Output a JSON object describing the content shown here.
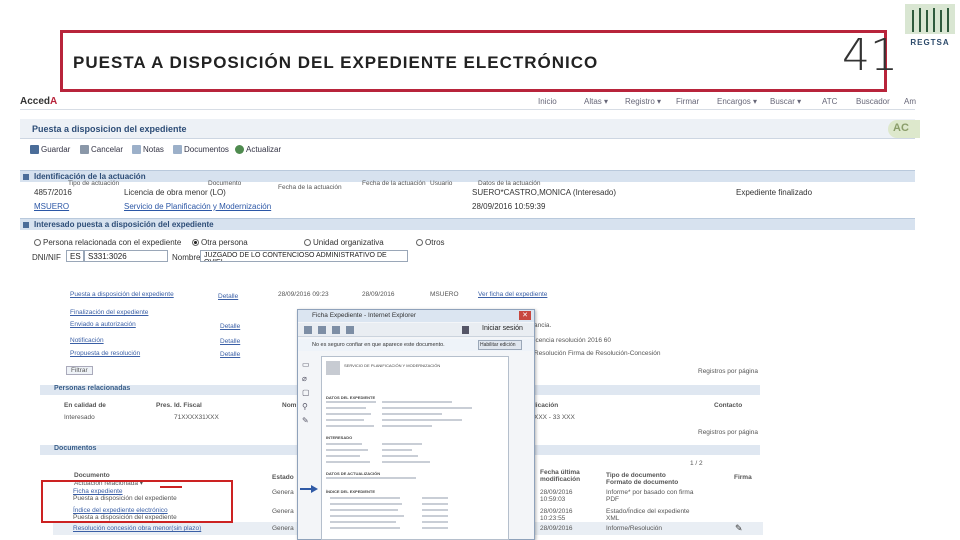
{
  "slide": {
    "title": "PUESTA A DISPOSICIÓN DEL EXPEDIENTE ELECTRÓNICO",
    "number": "41",
    "logo_text": "REGTSA"
  },
  "app": {
    "brand_prefix": "Acced",
    "brand_suffix": "A",
    "nav": [
      "Inicio",
      "Altas ▾",
      "Registro ▾",
      "Firmar",
      "Encargos ▾",
      "Buscar ▾",
      "ATC",
      "Buscador",
      "Am"
    ],
    "page_title": "Puesta a disposicion del expediente",
    "badge": "AC",
    "toolbar": [
      "Guardar",
      "Cancelar",
      "Notas",
      "Documentos",
      "Actualizar"
    ],
    "section_id": "Identificación de la actuación",
    "act": {
      "number": "4857/2016",
      "type": "Licencia de obra menor (LO)",
      "person": "SUERO*CASTRO,MONICA (Interesado)",
      "status": "Expediente finalizado",
      "user": "MSUERO",
      "service": "Servicio de Planificación y Modernización",
      "datetime": "28/09/2016 10:59:39"
    },
    "section_int": "Interesado puesta a disposición del expediente",
    "options": [
      "Persona relacionada con el expediente",
      "Otra persona",
      "Unidad organizativa",
      "Otros"
    ],
    "dni_label": "DNI/NIF",
    "dni_type": "ES",
    "dni_value": "S331:3026",
    "name_label": "Nombre",
    "name_value": "JUZGADO DE LO CONTENCIOSO ADMINISTRATIVO DE OVIEI"
  },
  "lower": {
    "header": [
      "Tipo de actuación",
      "Documento",
      "Fecha de la actuación",
      "Fecha de la actuación",
      "Usuario",
      "Datos de la actuación"
    ],
    "row1": {
      "type": "Puesta a disposición del expediente",
      "doc": "Detalle",
      "date1": "28/09/2016 09:23",
      "date2": "28/09/2016",
      "user": "MSUERO",
      "data": "Ver ficha del expediente"
    },
    "rows": [
      "Finalización del expediente",
      "Enviado a autorización",
      "Notificación",
      "Propuesta de resolución"
    ],
    "detail": "Detalle",
    "right_notes": [
      "ancia.",
      "icencia resolución 2016 60",
      "Resolución Firma de Resolución-Concesión"
    ],
    "filter": "Filtrar",
    "per_page": "Registros por página",
    "persons_title": "Personas relacionadas",
    "persons_cols": [
      "En calidad de",
      "Pres.",
      "Id. Fiscal",
      "Nom",
      "licación",
      "Contacto"
    ],
    "person": {
      "role": "Interesado",
      "id": "71XXXX31XXX",
      "loc": "XXX - 33 XXX"
    },
    "docs_title": "Documentos",
    "docs_cols": [
      "Documento",
      "Estado",
      "Fecha última modificación",
      "Tipo de documento",
      "Firma"
    ],
    "docs_sub": [
      "Actuación relacionada ▾",
      "Formato de documento"
    ],
    "pager": "1 / 2",
    "docs": [
      {
        "name": "Ficha expediente",
        "sub": "Puesta a disposición del expediente",
        "state": "Genera",
        "date": "28/09/2016",
        "time": "10:59:03",
        "type": "Informe* por basado con firma",
        "fmt": "PDF"
      },
      {
        "name": "Índice del expediente electrónico",
        "sub": "Puesta a disposición del expediente",
        "state": "Genera",
        "date": "28/09/2016",
        "time": "10:23:55",
        "type": "Estado/Índice del expediente",
        "fmt": "XML"
      },
      {
        "name": "Resolución concesión obra menor(sin plazo)",
        "sub": "",
        "state": "Genera",
        "date": "28/09/2016",
        "time": "",
        "type": "Informe/Resolución",
        "fmt": ""
      }
    ]
  },
  "popup": {
    "title": "Ficha Expediente - Internet Explorer",
    "login": "Iniciar sesión",
    "notice": "No es seguro confiar en que aparece este documento.",
    "notice_btn": "Habilitar edición",
    "doc_heading": "SERVICIO DE PLANIFICACIÓN Y MODERNIZACIÓN",
    "doc_sections": [
      "DATOS DEL EXPEDIENTE",
      "INTERESADO",
      "DATOS DE ACTUALIZACIÓN",
      "ÍNDICE DEL EXPEDIENTE"
    ]
  }
}
